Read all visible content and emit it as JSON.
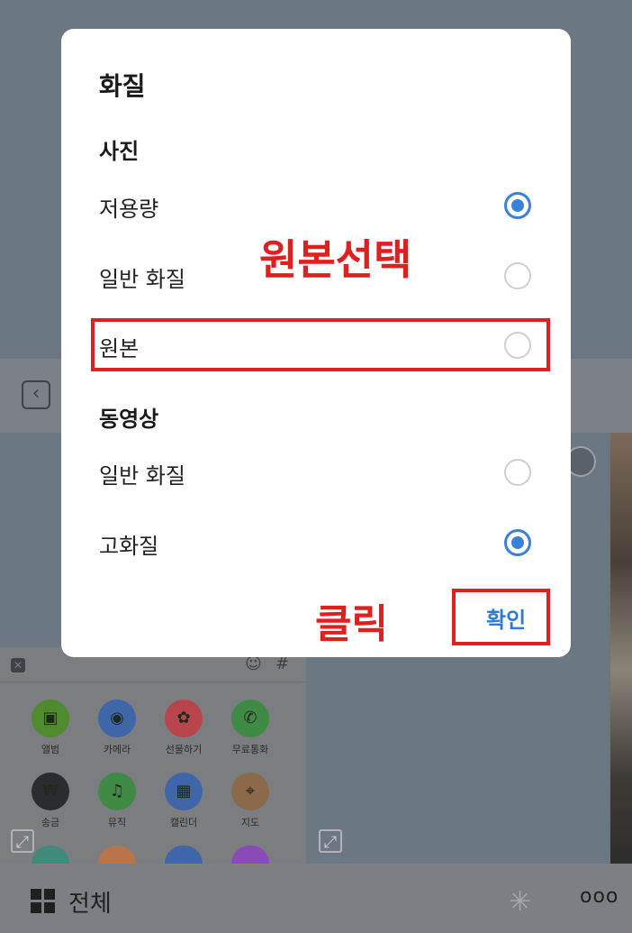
{
  "dialog": {
    "title": "화질",
    "photo_section": "사진",
    "photo_options": [
      {
        "label": "저용량",
        "selected": true
      },
      {
        "label": "일반 화질",
        "selected": false
      },
      {
        "label": "원본",
        "selected": false
      }
    ],
    "video_section": "동영상",
    "video_options": [
      {
        "label": "일반 화질",
        "selected": false
      },
      {
        "label": "고화질",
        "selected": true
      }
    ],
    "confirm_label": "확인"
  },
  "annotations": {
    "select_original": "원본선택",
    "click": "클릭"
  },
  "apps": [
    {
      "label": "앨범",
      "icon": "album-icon",
      "color": "#4f8a2e"
    },
    {
      "label": "카메라",
      "icon": "camera-icon",
      "color": "#3f66a8"
    },
    {
      "label": "선물하기",
      "icon": "gift-icon",
      "color": "#b8444c"
    },
    {
      "label": "무료통화",
      "icon": "phone-icon",
      "color": "#3f8a45"
    },
    {
      "label": "송금",
      "icon": "won-icon",
      "color": "#2a2c30"
    },
    {
      "label": "뮤직",
      "icon": "music-icon",
      "color": "#3f8a45"
    },
    {
      "label": "캘린더",
      "icon": "calendar-icon",
      "color": "#3f66a8"
    },
    {
      "label": "지도",
      "icon": "map-pin-icon",
      "color": "#8a6a4a"
    }
  ],
  "bottom_bar": {
    "all_label": "전체",
    "more_label": "ooo"
  },
  "colors": {
    "accent": "#3a82d8",
    "annotation": "#e0201e"
  }
}
